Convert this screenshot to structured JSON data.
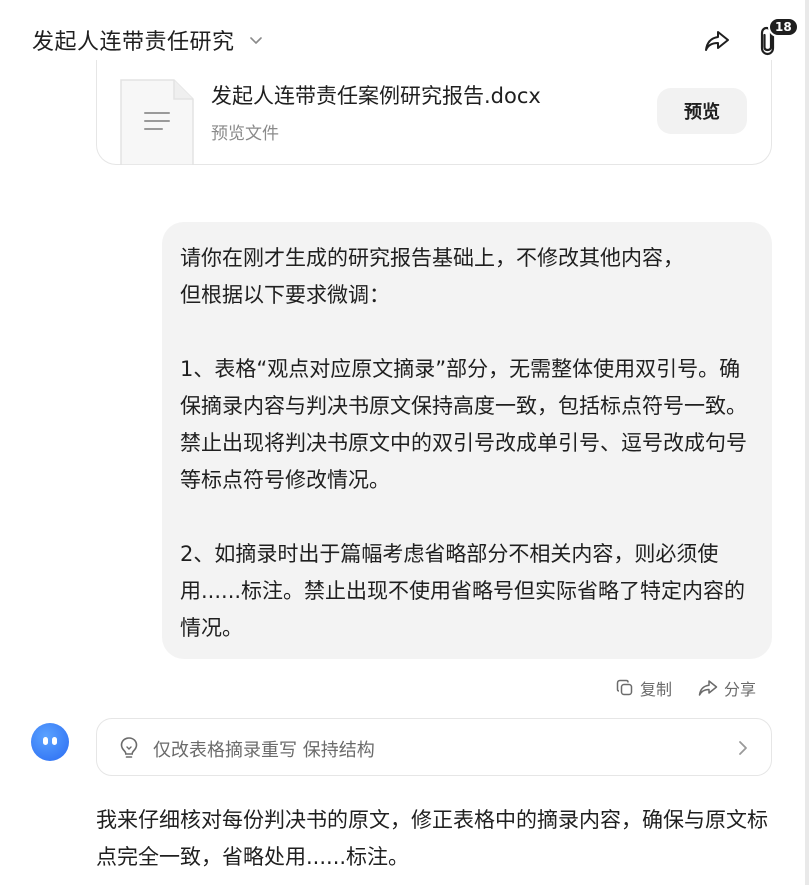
{
  "header": {
    "title": "发起人连带责任研究",
    "attachment_count": "18",
    "share_icon": "share-icon",
    "attach_icon": "paperclip-icon"
  },
  "file_card": {
    "file_name": "发起人连带责任案例研究报告.docx",
    "subtitle": "预览文件",
    "preview_label": "预览",
    "icon": "document-icon"
  },
  "user_message": {
    "lines": [
      "请你在刚才生成的研究报告基础上，不修改其他内容，",
      "但根据以下要求微调：",
      "",
      "1、表格“观点对应原文摘录”部分，无需整体使用双引号。确保摘录内容与判决书原文保持高度一致，包括标点符号一致。禁止出现将判决书原文中的双引号改成单引号、逗号改成句号等标点符号修改情况。",
      "",
      "2、如摘录时出于篇幅考虑省略部分不相关内容，则必须使用......标注。禁止出现不使用省略号但实际省略了特定内容的情况。"
    ]
  },
  "message_actions": {
    "copy_label": "复制",
    "share_label": "分享"
  },
  "suggestion": {
    "text": "仅改表格摘录重写 保持结构"
  },
  "assistant_reply": {
    "text": "我来仔细核对每份判决书的原文，修正表格中的摘录内容，确保与原文标点完全一致，省略处用......标注。"
  },
  "colors": {
    "accent": "#2a6bf2",
    "bubble": "#f3f3f3",
    "muted": "#6b6b6b"
  }
}
